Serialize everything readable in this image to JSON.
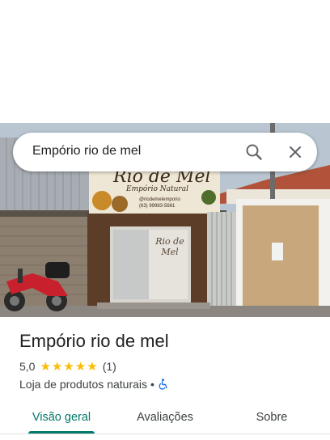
{
  "search": {
    "query": "Empório rio de mel"
  },
  "store_sign": {
    "name": "Rio de Mel",
    "subtitle": "Empório Natural",
    "instagram": "@riodemelemporio",
    "phone": "(63) 99983-5661"
  },
  "door_logo": "Rio de Mel",
  "place": {
    "title": "Empório rio de mel",
    "rating": "5,0",
    "stars": 5,
    "review_count": "(1)",
    "category": "Loja de produtos naturais",
    "separator": "•"
  },
  "tabs": [
    {
      "label": "Visão geral",
      "active": true
    },
    {
      "label": "Avaliações",
      "active": false
    },
    {
      "label": "Sobre",
      "active": false
    }
  ],
  "colors": {
    "accent": "#00796b",
    "star": "#fbbc04"
  }
}
